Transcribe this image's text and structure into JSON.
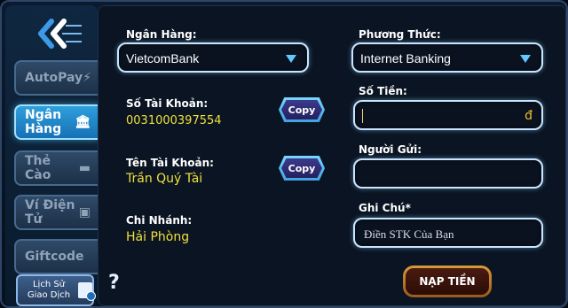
{
  "sidebar": {
    "items": [
      {
        "label": "AutoPay",
        "icon": "lightning-icon",
        "active": false
      },
      {
        "label": "Ngân Hàng",
        "icon": "bank-icon",
        "active": true
      },
      {
        "label": "Thẻ Cào",
        "icon": "card-icon",
        "active": false
      },
      {
        "label": "Ví Điện Tử",
        "icon": "wallet-icon",
        "active": false
      },
      {
        "label": "Giftcode",
        "icon": "gift-icon",
        "active": false
      }
    ],
    "history_label_1": "Lịch Sử",
    "history_label_2": "Giao Dịch"
  },
  "form": {
    "bank_label": "Ngân Hàng:",
    "bank_value": "VietcomBank",
    "method_label": "Phương Thức:",
    "method_value": "Internet Banking",
    "account_no_label": "Số Tài Khoản:",
    "account_no_value": "0031000397554",
    "amount_label": "Số Tiền:",
    "amount_currency": "đ",
    "account_name_label": "Tên Tài Khoản:",
    "account_name_value": "Trần Quý Tài",
    "sender_label": "Người Gửi:",
    "branch_label": "Chi Nhánh:",
    "branch_value": "Hải Phòng",
    "note_label": "Ghi Chú*",
    "note_placeholder": "Điền STK Của Bạn",
    "copy_label": "Copy",
    "help_text": "?",
    "submit_label": "NẠP TIỀN"
  },
  "colors": {
    "accent_yellow": "#f0e03c",
    "active_tab": "#2f9fdc",
    "field_border": "#c8e6ff",
    "caret": "#63c8ff"
  }
}
